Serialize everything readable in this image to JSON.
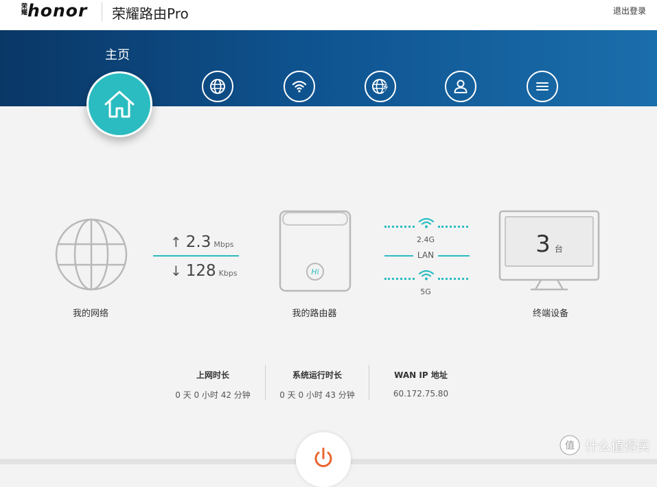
{
  "header": {
    "brand_cn": "荣耀",
    "brand_logo": "honor",
    "product_name": "荣耀路由Pro",
    "logout_label": "退出登录"
  },
  "nav": {
    "active_label": "主页",
    "items": [
      {
        "icon": "home-icon"
      },
      {
        "icon": "globe-icon"
      },
      {
        "icon": "wifi-icon"
      },
      {
        "icon": "globe-bolt-icon"
      },
      {
        "icon": "user-icon"
      },
      {
        "icon": "menu-icon"
      }
    ]
  },
  "dashboard": {
    "network_label": "我的网络",
    "upload": {
      "value": "2.3",
      "unit": "Mbps"
    },
    "download": {
      "value": "128",
      "unit": "Kbps"
    },
    "router_label": "我的路由器",
    "router_badge": "Hi",
    "band_24": "2.4G",
    "band_lan": "LAN",
    "band_5": "5G",
    "devices": {
      "count": "3",
      "unit": "台",
      "label": "终端设备"
    }
  },
  "stats": [
    {
      "title": "上网时长",
      "value": "0 天 0 小时 42 分钟"
    },
    {
      "title": "系统运行时长",
      "value": "0 天 0 小时 43 分钟"
    },
    {
      "title": "WAN IP 地址",
      "value": "60.172.75.80"
    }
  ],
  "watermark": {
    "text": "什么值得买",
    "badge": "值"
  },
  "colors": {
    "accent": "#2bbcc1",
    "nav_band": "#0f5592",
    "power": "#e8642c"
  }
}
